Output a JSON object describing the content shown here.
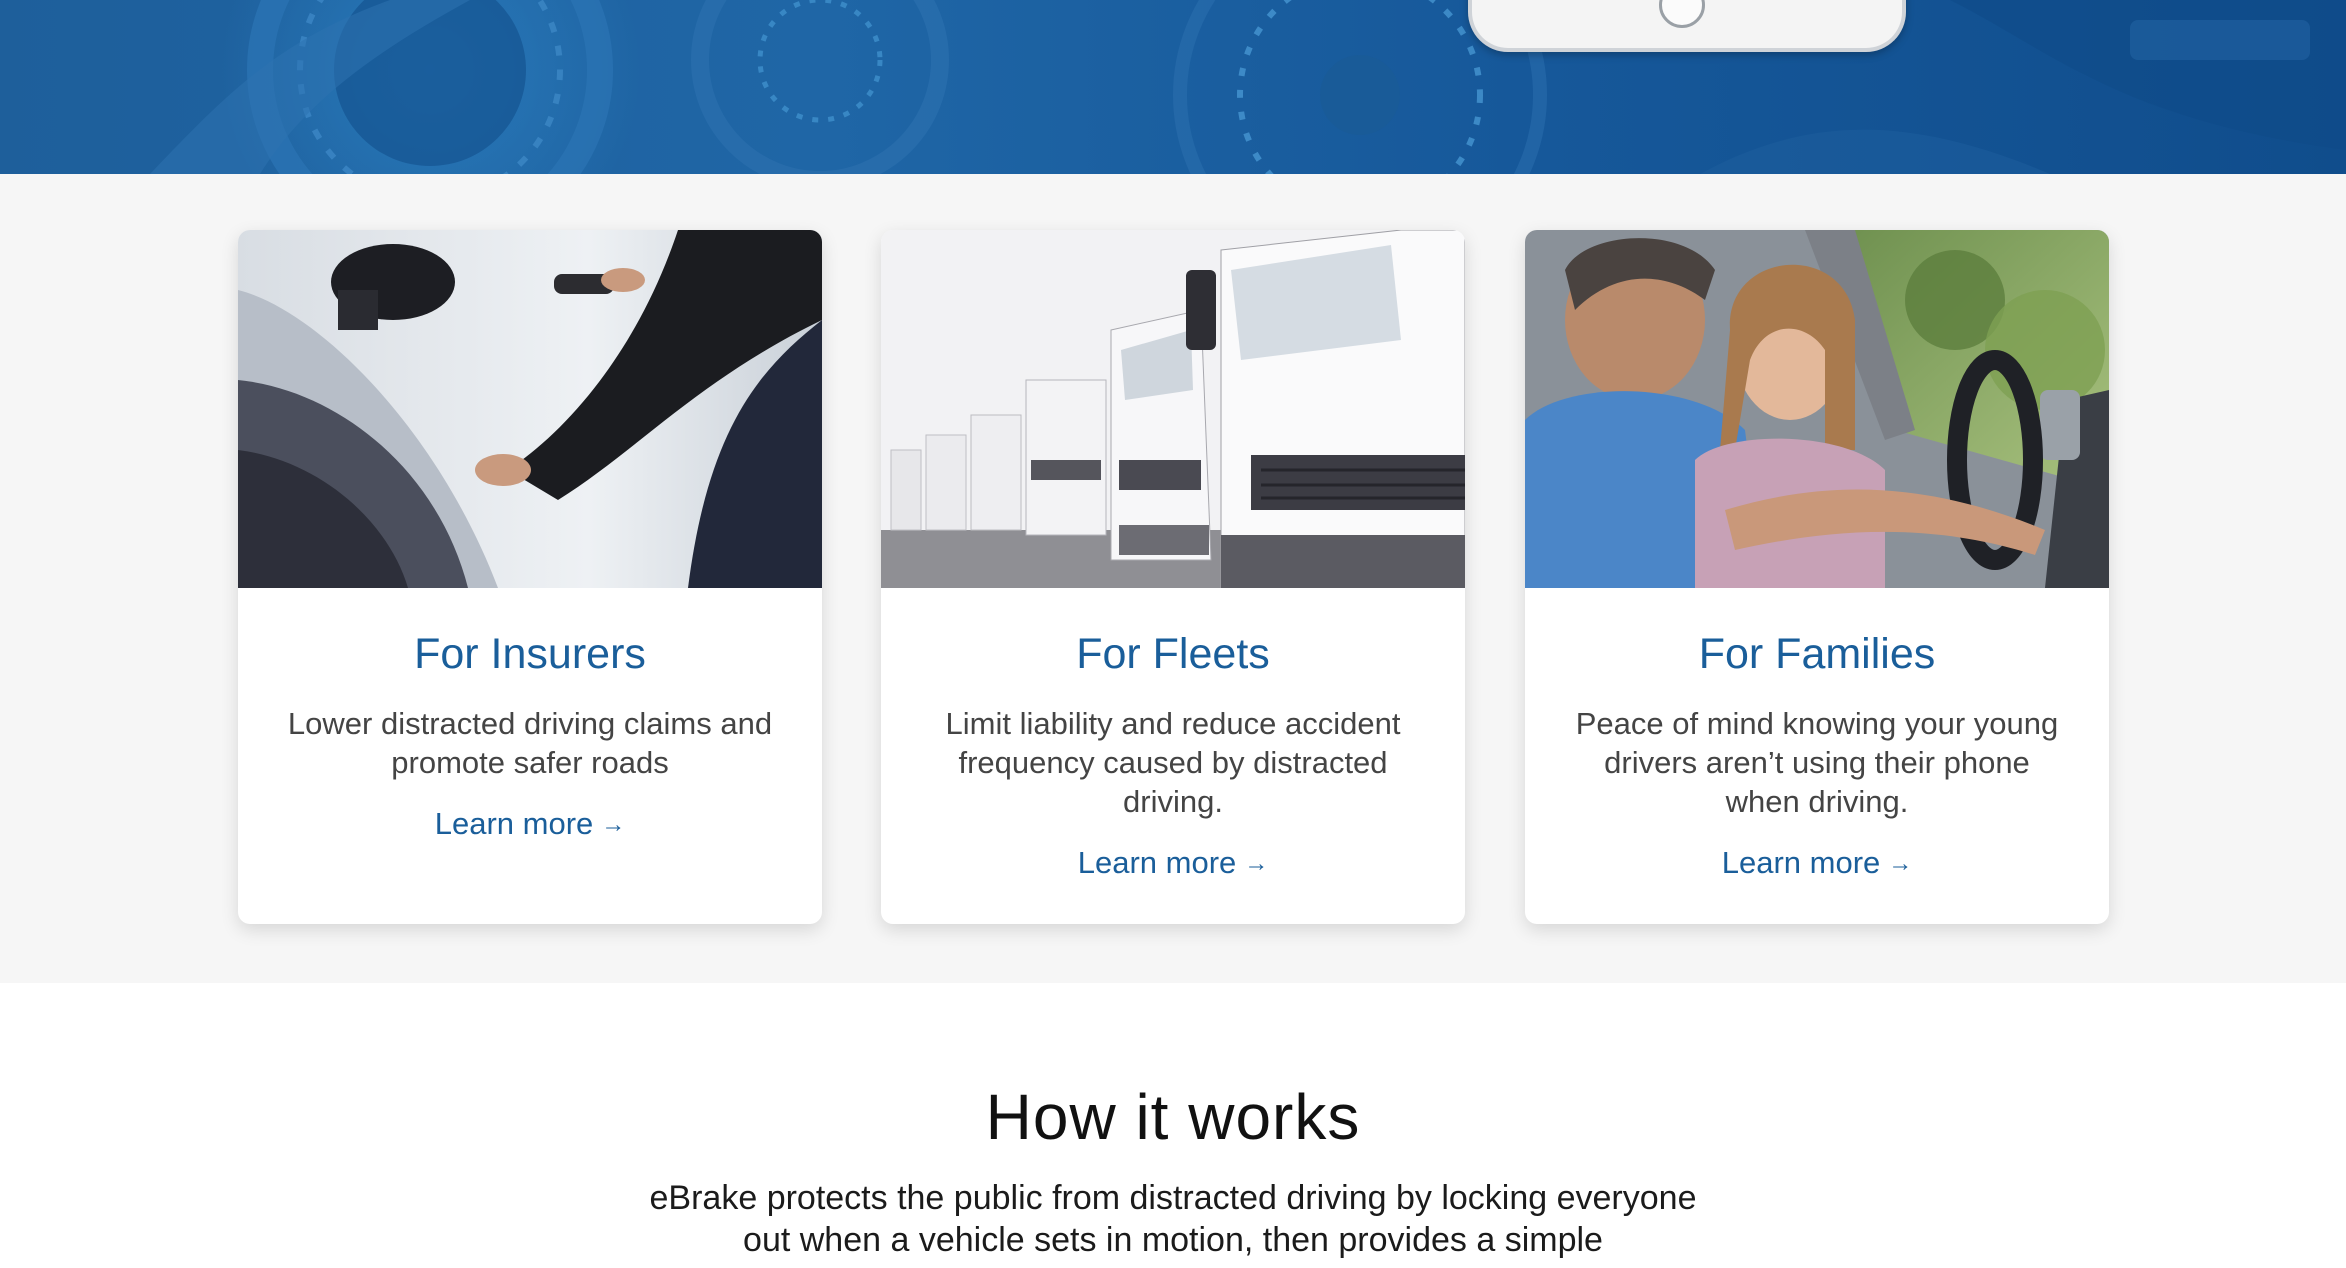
{
  "colors": {
    "accent": "#1a5e9a",
    "hero_blue": "#1f66a6",
    "band_gray": "#f6f6f6",
    "body_text": "#444444"
  },
  "cards": [
    {
      "title": "For Insurers",
      "text": "Lower distracted driving claims and promote safer roads",
      "link": "Learn more",
      "arrow": "→",
      "icon": "arrow-right-icon"
    },
    {
      "title": "For Fleets",
      "text": "Limit liability and reduce accident frequency caused by distracted driving.",
      "link": "Learn more",
      "arrow": "→",
      "icon": "arrow-right-icon"
    },
    {
      "title": "For Families",
      "text": "Peace of mind knowing your young drivers aren’t using their phone when driving.",
      "link": "Learn more",
      "arrow": "→",
      "icon": "arrow-right-icon"
    }
  ],
  "how_it_works": {
    "title": "How it works",
    "text": "eBrake protects the public from distracted driving by locking everyone out when a vehicle sets in motion, then provides a simple"
  }
}
